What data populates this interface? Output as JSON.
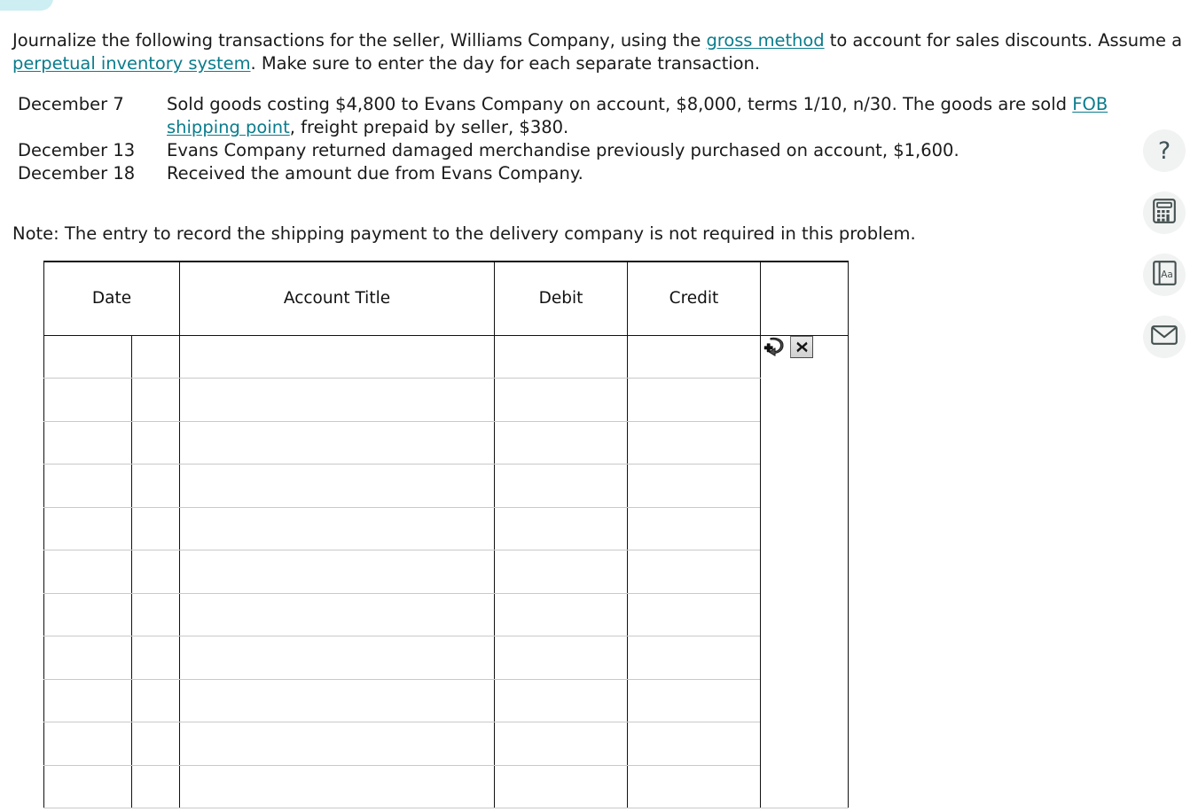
{
  "badge": {
    "name": "status-badge"
  },
  "intro": {
    "line1_a": "Journalize the following transactions for the seller, Williams Company, using the ",
    "link1": "gross method",
    "line1_b": " to account for sales discounts. Assume a ",
    "link2": "perpetual inventory system",
    "line1_c": ". Make sure to enter the day for each separate transaction."
  },
  "transactions": [
    {
      "date": "December 7",
      "desc_a": "Sold goods costing $4,800 to Evans Company on account, $8,000, terms 1/10, n/30. The goods are sold ",
      "link": "FOB shipping point",
      "desc_b": ", freight prepaid by seller, $380."
    },
    {
      "date": "December 13",
      "desc_a": "Evans Company returned damaged merchandise previously purchased on account, $1,600.",
      "link": "",
      "desc_b": ""
    },
    {
      "date": "December 18",
      "desc_a": "Received the amount due from Evans Company.",
      "link": "",
      "desc_b": ""
    }
  ],
  "note": "Note: The entry to record the shipping payment to the delivery company is not required in this problem.",
  "table": {
    "headers": [
      "Date",
      "Account Title",
      "Debit",
      "Credit",
      ""
    ],
    "row_count": 11,
    "rows": [
      {
        "date_day": "",
        "date_num": "",
        "account_title": "",
        "debit": "",
        "credit": ""
      },
      {
        "date_day": "",
        "date_num": "",
        "account_title": "",
        "debit": "",
        "credit": ""
      },
      {
        "date_day": "",
        "date_num": "",
        "account_title": "",
        "debit": "",
        "credit": ""
      },
      {
        "date_day": "",
        "date_num": "",
        "account_title": "",
        "debit": "",
        "credit": ""
      },
      {
        "date_day": "",
        "date_num": "",
        "account_title": "",
        "debit": "",
        "credit": ""
      },
      {
        "date_day": "",
        "date_num": "",
        "account_title": "",
        "debit": "",
        "credit": ""
      },
      {
        "date_day": "",
        "date_num": "",
        "account_title": "",
        "debit": "",
        "credit": ""
      },
      {
        "date_day": "",
        "date_num": "",
        "account_title": "",
        "debit": "",
        "credit": ""
      },
      {
        "date_day": "",
        "date_num": "",
        "account_title": "",
        "debit": "",
        "credit": ""
      },
      {
        "date_day": "",
        "date_num": "",
        "account_title": "",
        "debit": "",
        "credit": ""
      },
      {
        "date_day": "",
        "date_num": "",
        "account_title": "",
        "debit": "",
        "credit": ""
      }
    ],
    "actions": {
      "add_row_icon": "add-row-icon",
      "delete_row_label": "✖"
    }
  },
  "rail": {
    "items": [
      {
        "icon": "help-icon",
        "glyph": "?",
        "label": "Help"
      },
      {
        "icon": "calculator-icon",
        "glyph": "",
        "label": "Calculator"
      },
      {
        "icon": "dictionary-icon",
        "glyph": "Aa",
        "label": "Dictionary"
      },
      {
        "icon": "mail-icon",
        "glyph": "",
        "label": "Message"
      }
    ]
  },
  "colors": {
    "link": "#0a7c8c",
    "badge": "#cdeef3",
    "badge_tick": "#22c0dd",
    "rail_bg": "#f1f2f2",
    "rail_icon": "#44504f",
    "table_border_dark": "#111111",
    "table_border_light": "#c9c9c9"
  }
}
